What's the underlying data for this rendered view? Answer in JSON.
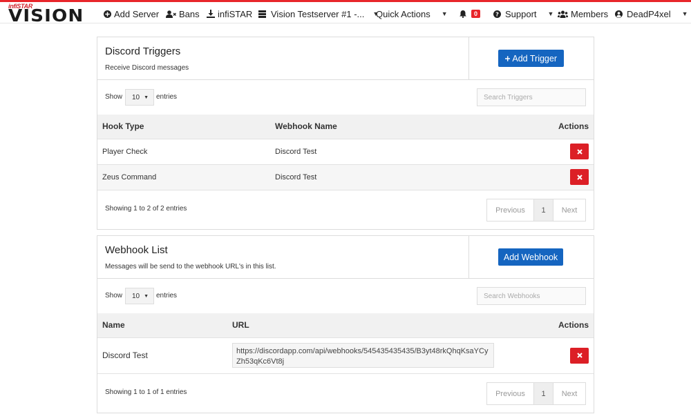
{
  "logo": {
    "small": "infiSTAR",
    "big": "VISION"
  },
  "nav": {
    "add_server": "Add Server",
    "bans": "Bans",
    "infistar": "infiSTAR",
    "server": "Vision Testserver #1 -...",
    "quick_actions": "Quick Actions",
    "notifications_count": "0",
    "support": "Support",
    "members": "Members",
    "user": "DeadP4xel"
  },
  "triggers": {
    "title": "Discord Triggers",
    "subtitle": "Receive Discord messages",
    "add_button": "Add Trigger",
    "show_label": "Show",
    "entries_value": "10",
    "entries_label": "entries",
    "search_placeholder": "Search Triggers",
    "columns": [
      "Hook Type",
      "Webhook Name",
      "Actions"
    ],
    "rows": [
      {
        "hook_type": "Player Check",
        "webhook_name": "Discord Test"
      },
      {
        "hook_type": "Zeus Command",
        "webhook_name": "Discord Test"
      }
    ],
    "showing": "Showing 1 to 2 of 2 entries",
    "pager": {
      "prev": "Previous",
      "page": "1",
      "next": "Next"
    }
  },
  "webhooks": {
    "title": "Webhook List",
    "subtitle": "Messages will be send to the webhook URL's in this list.",
    "add_button": "Add Webhook",
    "show_label": "Show",
    "entries_value": "10",
    "entries_label": "entries",
    "search_placeholder": "Search Webhooks",
    "columns": [
      "Name",
      "URL",
      "Actions"
    ],
    "rows": [
      {
        "name": "Discord Test",
        "url": "https://discordapp.com/api/webhooks/545435435435/B3yt48rkQhqKsaYCyZh53qKc6Vt8j"
      }
    ],
    "showing": "Showing 1 to 1 of 1 entries",
    "pager": {
      "prev": "Previous",
      "page": "1",
      "next": "Next"
    }
  },
  "colors": {
    "accent_red": "#e8262b",
    "primary_blue": "#1565c0",
    "danger": "#dc1f26"
  }
}
